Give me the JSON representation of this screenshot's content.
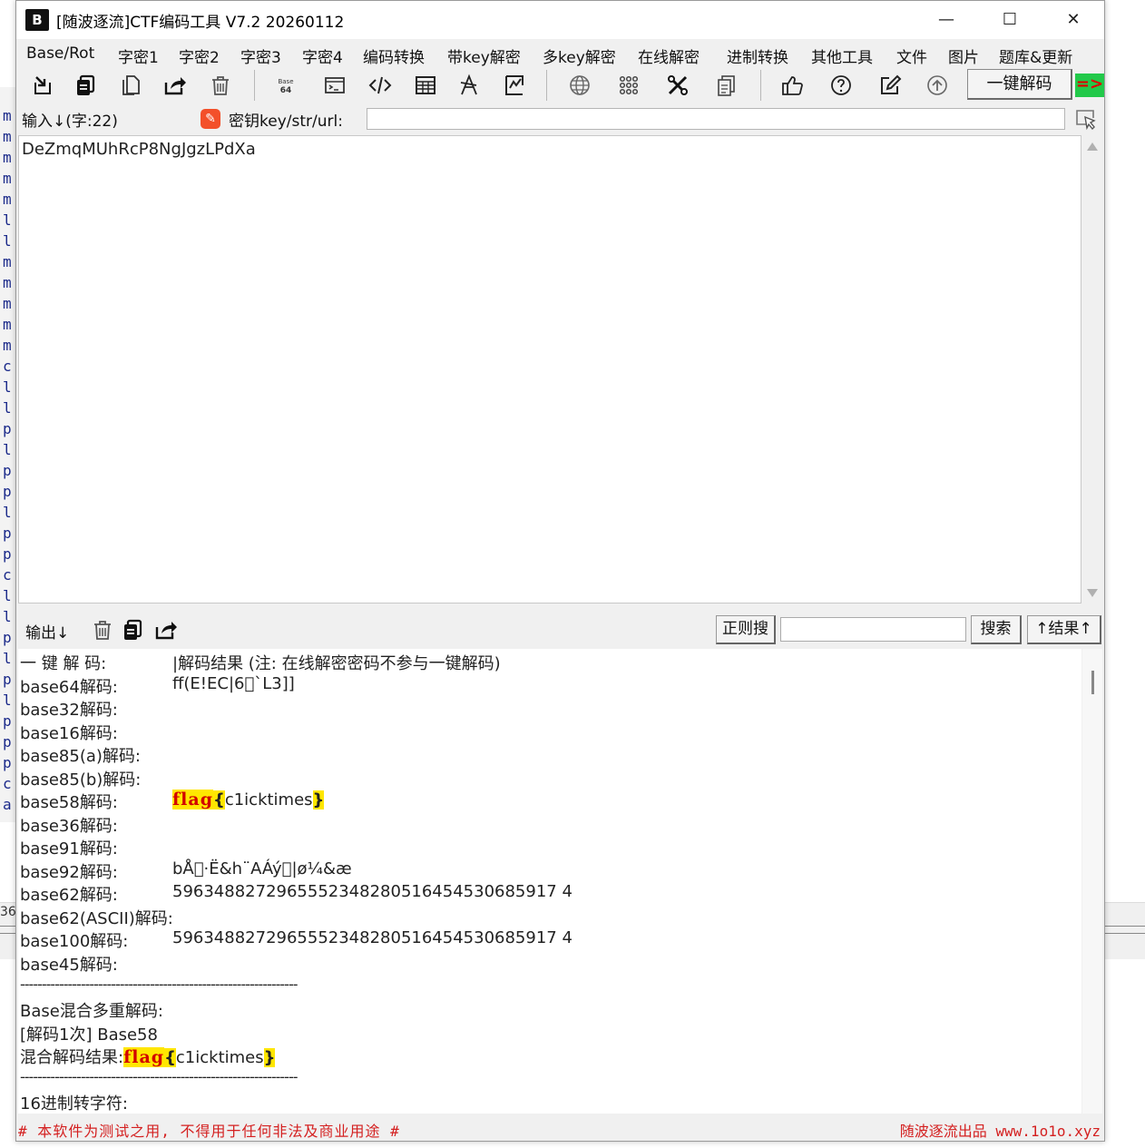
{
  "window": {
    "title": "[随波逐流]CTF编码工具 V7.2  20260112",
    "logo_text": "B",
    "minimize": "—",
    "maximize": "☐",
    "close": "✕"
  },
  "menu": [
    "Base/Rot",
    "字密1",
    "字密2",
    "字密3",
    "字密4",
    "编码转换",
    "带key解密",
    "多key解密",
    "在线解密",
    "进制转换",
    "其他工具",
    "文件",
    "图片",
    "题库&更新"
  ],
  "toolbar": {
    "icons": [
      "import-icon",
      "copy-icon",
      "paste-icon",
      "share-icon",
      "trash-icon",
      "base64-icon",
      "terminal-icon",
      "code-icon",
      "table-icon",
      "font-icon",
      "sign-icon",
      "globe-icon",
      "grid-icon",
      "tools-icon",
      "document-icon",
      "thumbs-up-icon",
      "help-icon",
      "edit-icon",
      "upload-icon"
    ],
    "one_key_decode": "一键解码",
    "arrow": "=>"
  },
  "key_row": {
    "input_label": "输入↓(字:22)",
    "key_label": "密钥key/str/url:",
    "key_value": ""
  },
  "input": {
    "text": "DeZmqMUhRcP8NgJgzLPdXa"
  },
  "output_header": {
    "label": "输出↓",
    "regex_button": "正则搜",
    "search_value": "",
    "search_button": "搜索",
    "result_button": "↑结果↑"
  },
  "output": {
    "rows": [
      {
        "label": "一 键 解 码:",
        "value": "|解码结果 (注: 在线解密密码不参与一键解码)"
      },
      {
        "label": "base64解码:",
        "value": "ff(E!EC|6\u0000`L3]]"
      },
      {
        "label": "base32解码:",
        "value": ""
      },
      {
        "label": "base16解码:",
        "value": ""
      },
      {
        "label": "base85(a)解码:",
        "value": ""
      },
      {
        "label": "base85(b)解码:",
        "value": ""
      },
      {
        "label": "base58解码:",
        "value": ""
      },
      {
        "label": "base36解码:",
        "value": ""
      },
      {
        "label": "base91解码:",
        "value": ""
      },
      {
        "label": "base92解码:",
        "value": "bÅ\u0000·Ë&h¨AÁý\u0000|ø¼&æ"
      },
      {
        "label": "base62解码:",
        "value": "5963488272965552348280516454530685917 4"
      },
      {
        "label": "base62(ASCII)解码:",
        "value": ""
      },
      {
        "label": "base100解码:",
        "value": "5963488272965552348280516454530685917 4"
      },
      {
        "label": "base45解码:",
        "value": ""
      }
    ],
    "flag_word": "flag",
    "flag_open": "{",
    "flag_inner": "c1icktimes",
    "flag_close": "}",
    "divider": "----------------------------------------------------------------",
    "mixed_title": "Base混合多重解码:",
    "mixed_step": "[解码1次] Base58",
    "mixed_result_label": "混合解码结果:",
    "hex_title": "16进制转字符:"
  },
  "status": {
    "left": "# 本软件为测试之用, 不得用于任何非法及商业用途 #",
    "right": "随波逐流出品 www.1o1o.xyz"
  },
  "background_window": {
    "lines": [
      "m",
      "m",
      "m",
      "m",
      "m",
      "l",
      "l",
      "m",
      "m",
      "m",
      "m",
      "m",
      "c",
      "l",
      "l",
      "p",
      "l",
      "p",
      "p",
      "l",
      "p",
      "p",
      "c",
      "l",
      "l",
      "p",
      "l",
      "p",
      "l",
      "p",
      "p",
      "p",
      "c",
      "a"
    ],
    "strip_number": "36"
  },
  "colors": {
    "flag_bg": "#ffe600",
    "flag_text": "#d10000",
    "status_text": "#d42020",
    "arrow_bg": "#22c94a"
  }
}
